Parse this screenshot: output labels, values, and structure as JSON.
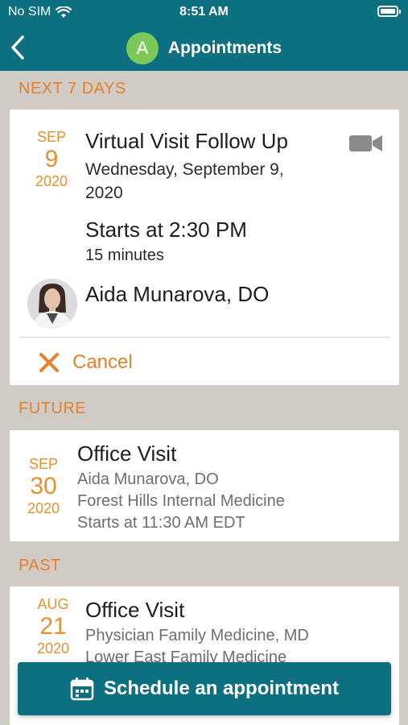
{
  "status_bar": {
    "carrier": "No SIM",
    "time": "8:51 AM"
  },
  "nav": {
    "avatar_letter": "A",
    "title": "Appointments"
  },
  "sections": {
    "next7": "NEXT 7 DAYS",
    "future": "FUTURE",
    "past": "PAST"
  },
  "upcoming": {
    "month": "SEP",
    "day": "9",
    "year": "2020",
    "title": "Virtual Visit Follow Up",
    "date_text": "Wednesday, September 9, 2020",
    "starts": "Starts at 2:30 PM",
    "duration": "15 minutes",
    "provider": "Aida Munarova, DO",
    "cancel_label": "Cancel",
    "type_icon": "video-camera-icon"
  },
  "future_appt": {
    "month": "SEP",
    "day": "30",
    "year": "2020",
    "title": "Office Visit",
    "provider": "Aida Munarova, DO",
    "location": "Forest Hills Internal Medicine",
    "starts": "Starts at 11:30 AM EDT"
  },
  "past_appt": {
    "month": "AUG",
    "day": "21",
    "year": "2020",
    "title": "Office Visit",
    "provider": "Physician Family Medicine, MD",
    "location": "Lower East Family Medicine"
  },
  "schedule_button": {
    "label": "Schedule an appointment"
  },
  "colors": {
    "brand_teal": "#0d7080",
    "accent_orange": "#e8802b",
    "background": "#cfcbc5",
    "avatar_green": "#7cc95a"
  }
}
